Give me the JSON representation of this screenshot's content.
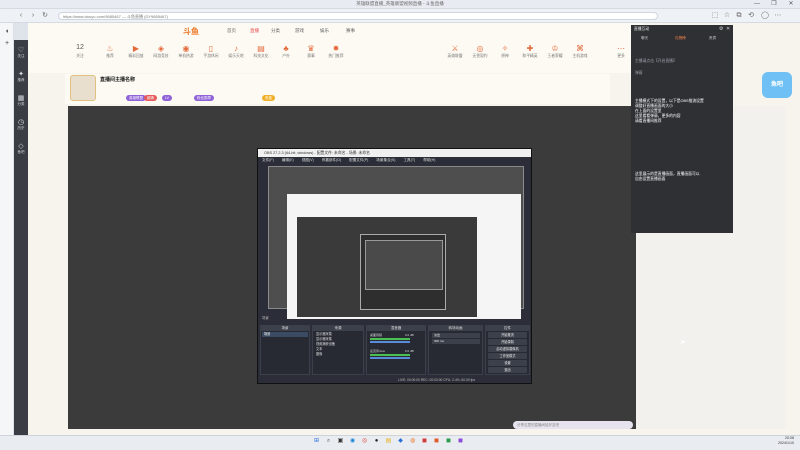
{
  "browser": {
    "window_title": "英雄联盟直播_英雄联盟视频直播 - 斗鱼直播",
    "url": "https://www.douyu.com/9685467 — 斗鱼直播 (DY9685467)",
    "window_controls": [
      "—",
      "❐",
      "✕"
    ]
  },
  "nav": {
    "logo": "斗鱼",
    "items": [
      "首页",
      "直播",
      "分类",
      "游戏",
      "娱乐",
      "赛事"
    ],
    "active": "直播"
  },
  "categories": {
    "count_label": "12",
    "items": [
      "关注",
      "推荐",
      "精彩回放",
      "网游竞技",
      "单机热游",
      "手游休闲",
      "娱乐天地",
      "科技文化",
      "户外",
      "赛事",
      "热门推荐",
      "英雄联盟",
      "无畏契约",
      "原神",
      "和平精英",
      "王者荣耀",
      "主机游戏",
      "更多"
    ]
  },
  "left_rail": {
    "items": [
      "关注",
      "推荐",
      "分类",
      "历史",
      "鱼吧"
    ]
  },
  "room": {
    "title": "直播间主播名称",
    "tags": [
      "英雄联盟",
      "超清",
      "LV",
      "粉丝勋章",
      "贵族"
    ],
    "tag_colors": [
      "#8f62d8",
      "#e55a5a",
      "#8f62d8",
      "#8f62d8",
      "#f0b02a"
    ]
  },
  "obs": {
    "window_title": "OBS 27.2.3 (64-bit, windows) - 配置文件: 未命名 - 场景: 未命名",
    "menu": [
      "文件(F)",
      "编辑(E)",
      "视图(V)",
      "停靠部件(D)",
      "配置文件(P)",
      "场景集合(S)",
      "工具(T)",
      "帮助(H)"
    ],
    "docks": {
      "scenes": "场景",
      "sources": "来源",
      "mixer": "混音器",
      "transitions": "转场动画",
      "controls": "控件"
    },
    "scene_label": "场景",
    "sources_list": [
      "显示器采集",
      "显示器采集",
      "视频捕获设备",
      "文本",
      "图像"
    ],
    "mixer_tracks": [
      "桌面音频",
      "麦克风/Aux"
    ],
    "mixer_values": [
      "0.0 dB",
      "0.0 dB"
    ],
    "transition_name": "淡出",
    "transition_duration": "300 ms",
    "control_buttons": [
      "开始推流",
      "开始录制",
      "启动虚拟摄像机",
      "工作室模式",
      "设置",
      "退出"
    ],
    "status": "LIVE: 00:00:00   REC: 00:00:00   CPU: 2.4%, 60.00 fps"
  },
  "chat": {
    "title": "直播互动",
    "tabs": [
      "聊天",
      "礼物榜",
      "贵宾"
    ],
    "lines": [
      "主播请点击【开启直播】",
      "弹幕",
      "主播模式下的设置，以下是OBS推流设置",
      "调整好直播画面的大小",
      "在上面的设置里",
      "这里看看弹幕，更多的内容",
      "请看直播间推荐"
    ],
    "paragraph_2": [
      "这里展示的是直播画面，直播画面可以",
      "自由设置直播画面"
    ]
  },
  "bottom_input": "分享这里的直播间给好友吧",
  "float_badge": "鱼吧",
  "taskbar": {
    "apps": [
      {
        "icon": "windows-icon",
        "glyph": "⊞",
        "color": "#2f74e0"
      },
      {
        "icon": "search-icon",
        "glyph": "⌕",
        "color": "#555"
      },
      {
        "icon": "taskview-icon",
        "glyph": "▣",
        "color": "#333"
      },
      {
        "icon": "edge-icon",
        "glyph": "◉",
        "color": "#1a86d8"
      },
      {
        "icon": "chrome-icon",
        "glyph": "◎",
        "color": "#e33f2f"
      },
      {
        "icon": "obs-icon",
        "glyph": "●",
        "color": "#222"
      },
      {
        "icon": "folder-icon",
        "glyph": "▤",
        "color": "#e8b323"
      },
      {
        "icon": "store-icon",
        "glyph": "◆",
        "color": "#2b6fd6"
      },
      {
        "icon": "douyu-icon",
        "glyph": "◍",
        "color": "#f07a2a"
      },
      {
        "icon": "app-icon",
        "glyph": "◼",
        "color": "#d23a3a"
      },
      {
        "icon": "app-icon",
        "glyph": "◼",
        "color": "#e05a2a"
      },
      {
        "icon": "app-icon",
        "glyph": "◼",
        "color": "#2a9b4a"
      },
      {
        "icon": "app-icon",
        "glyph": "◼",
        "color": "#8c4bd6"
      }
    ],
    "time": "20:08",
    "date": "2024/1/10"
  }
}
